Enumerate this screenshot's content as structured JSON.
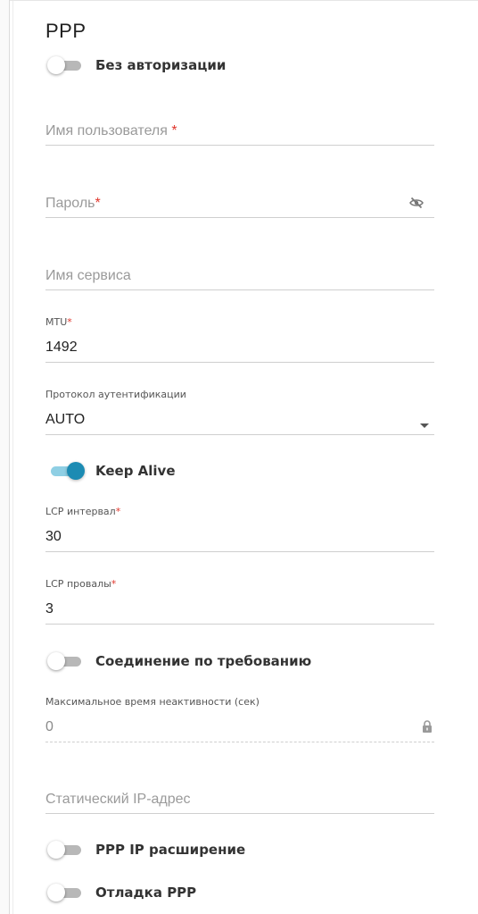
{
  "section_title": "PPP",
  "toggles": {
    "no_auth": {
      "label": "Без авторизации",
      "on": false
    },
    "keep_alive": {
      "label": "Keep Alive",
      "on": true
    },
    "on_demand": {
      "label": "Соединение по требованию",
      "on": false
    },
    "ppp_ip_ext": {
      "label": "PPP IP расширение",
      "on": false
    },
    "debug": {
      "label": "Отладка PPP",
      "on": false
    }
  },
  "fields": {
    "username": {
      "placeholder": "Имя пользователя",
      "required_mark": " *"
    },
    "password": {
      "placeholder": "Пароль",
      "required_mark": "*"
    },
    "service_name": {
      "placeholder": "Имя сервиса"
    },
    "mtu": {
      "label": "MTU",
      "required_mark": "*",
      "value": "1492"
    },
    "auth_protocol": {
      "label": "Протокол аутентификации",
      "value": "AUTO"
    },
    "lcp_interval": {
      "label": "LCP интервал",
      "required_mark": "*",
      "value": "30"
    },
    "lcp_fails": {
      "label": "LCP провалы",
      "required_mark": "*",
      "value": "3"
    },
    "max_idle": {
      "label": "Максимальное время неактивности (сек)",
      "value": "0"
    },
    "static_ip": {
      "placeholder": "Статический IP-адрес"
    }
  },
  "icons": {
    "password_toggle": "eye-off-icon",
    "dropdown": "caret-down-icon",
    "lock": "lock-icon"
  },
  "colors": {
    "accent": "#1c8bb3",
    "accent_track": "#8fcfe4",
    "required": "#e0362c"
  }
}
